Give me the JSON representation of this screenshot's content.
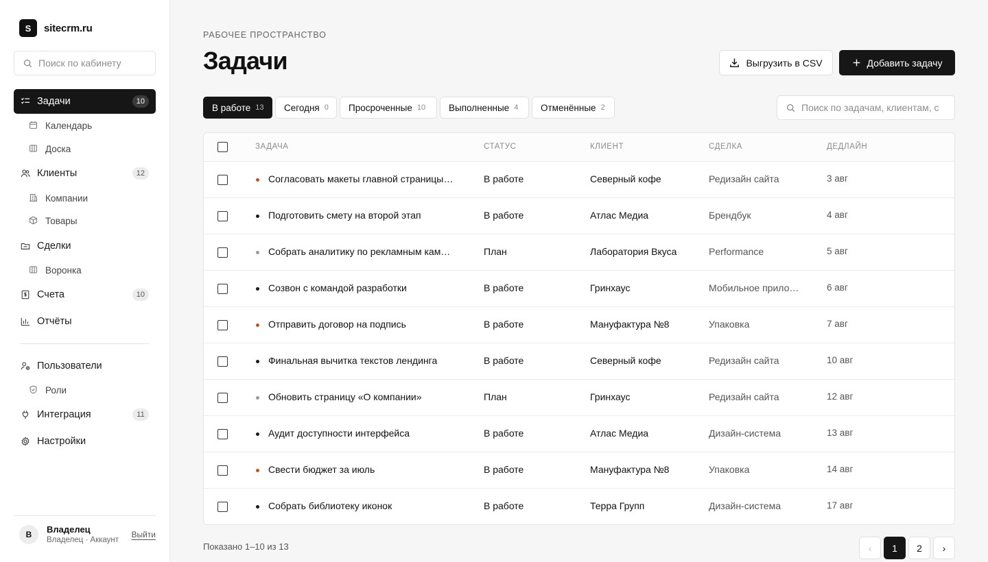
{
  "brand": {
    "mark": "S",
    "name": "sitecrm.ru"
  },
  "sidebar": {
    "search_placeholder": "Поиск по кабинету",
    "items": [
      {
        "label": "Задачи",
        "badge": "10",
        "icon": "task-list-icon",
        "active": true
      },
      {
        "label": "Календарь",
        "icon": "calendar-icon",
        "sub": true
      },
      {
        "label": "Доска",
        "icon": "board-icon",
        "sub": true
      },
      {
        "label": "Клиенты",
        "badge": "12",
        "icon": "users-icon"
      },
      {
        "label": "Компании",
        "icon": "building-icon",
        "sub": true
      },
      {
        "label": "Товары",
        "icon": "box-icon",
        "sub": true
      },
      {
        "label": "Сделки",
        "icon": "folder-icon"
      },
      {
        "label": "Воронка",
        "icon": "funnel-board-icon",
        "sub": true
      },
      {
        "label": "Счета",
        "badge": "10",
        "icon": "invoice-icon"
      },
      {
        "label": "Отчёты",
        "icon": "bar-chart-icon"
      },
      {
        "label": "Пользователи",
        "icon": "user-group-icon"
      },
      {
        "label": "Роли",
        "icon": "shield-icon",
        "sub": true
      },
      {
        "label": "Интеграция",
        "badge": "11",
        "icon": "plug-icon"
      },
      {
        "label": "Настройки",
        "icon": "gear-icon"
      }
    ]
  },
  "user": {
    "initial": "В",
    "name": "Владелец",
    "sub": "Владелец · Аккаунт",
    "logout": "Выйти"
  },
  "header": {
    "eyebrow": "РАБОЧЕЕ ПРОСТРАНСТВО",
    "title": "Задачи",
    "export_label": "Выгрузить в CSV",
    "add_label": "Добавить задачу"
  },
  "tabs": [
    {
      "label": "В работе",
      "count": "13",
      "active": true
    },
    {
      "label": "Сегодня",
      "count": "0"
    },
    {
      "label": "Просроченные",
      "count": "10"
    },
    {
      "label": "Выполненные",
      "count": "4"
    },
    {
      "label": "Отменённые",
      "count": "2"
    }
  ],
  "task_search_placeholder": "Поиск по задачам, клиентам, сделкам",
  "table": {
    "columns": [
      "ЗАДАЧА",
      "СТАТУС",
      "КЛИЕНТ",
      "СДЕЛКА",
      "ДЕДЛАЙН"
    ],
    "rows": [
      {
        "task": "Согласовать макеты главной страницы сайта",
        "status": "В работе",
        "client": "Северный кофе",
        "deal": "Редизайн сайта",
        "deadline": "3 авг",
        "priority_color": "#b5552a"
      },
      {
        "task": "Подготовить смету на второй этап",
        "status": "В работе",
        "client": "Атлас Медиа",
        "deal": "Брендбук",
        "deadline": "4 авг",
        "priority_color": "#1a1a1a"
      },
      {
        "task": "Собрать аналитику по рекламным кампаниям",
        "status": "План",
        "client": "Лаборатория Вкуса",
        "deal": "Performance",
        "deadline": "5 авг",
        "priority_color": "#9a9a9a"
      },
      {
        "task": "Созвон с командой разработки",
        "status": "В работе",
        "client": "Гринхаус",
        "deal": "Мобильное приложение",
        "deadline": "6 авг",
        "priority_color": "#1a1a1a"
      },
      {
        "task": "Отправить договор на подпись",
        "status": "В работе",
        "client": "Мануфактура №8",
        "deal": "Упаковка",
        "deadline": "7 авг",
        "priority_color": "#b5552a"
      },
      {
        "task": "Финальная вычитка текстов лендинга",
        "status": "В работе",
        "client": "Северный кофе",
        "deal": "Редизайн сайта",
        "deadline": "10 авг",
        "priority_color": "#1a1a1a"
      },
      {
        "task": "Обновить страницу «О компании»",
        "status": "План",
        "client": "Гринхаус",
        "deal": "Редизайн сайта",
        "deadline": "12 авг",
        "priority_color": "#9a9a9a"
      },
      {
        "task": "Аудит доступности интерфейса",
        "status": "В работе",
        "client": "Атлас Медиа",
        "deal": "Дизайн-система",
        "deadline": "13 авг",
        "priority_color": "#1a1a1a"
      },
      {
        "task": "Свести бюджет за июль",
        "status": "В работе",
        "client": "Мануфактура №8",
        "deal": "Упаковка",
        "deadline": "14 авг",
        "priority_color": "#b5552a"
      },
      {
        "task": "Собрать библиотеку иконок",
        "status": "В работе",
        "client": "Терра Групп",
        "deal": "Дизайн-система",
        "deadline": "17 авг",
        "priority_color": "#1a1a1a"
      }
    ]
  },
  "footer": {
    "shown": "Показано 1–10 из 13",
    "pages": [
      "1",
      "2"
    ],
    "prev": "‹",
    "next": "›"
  }
}
